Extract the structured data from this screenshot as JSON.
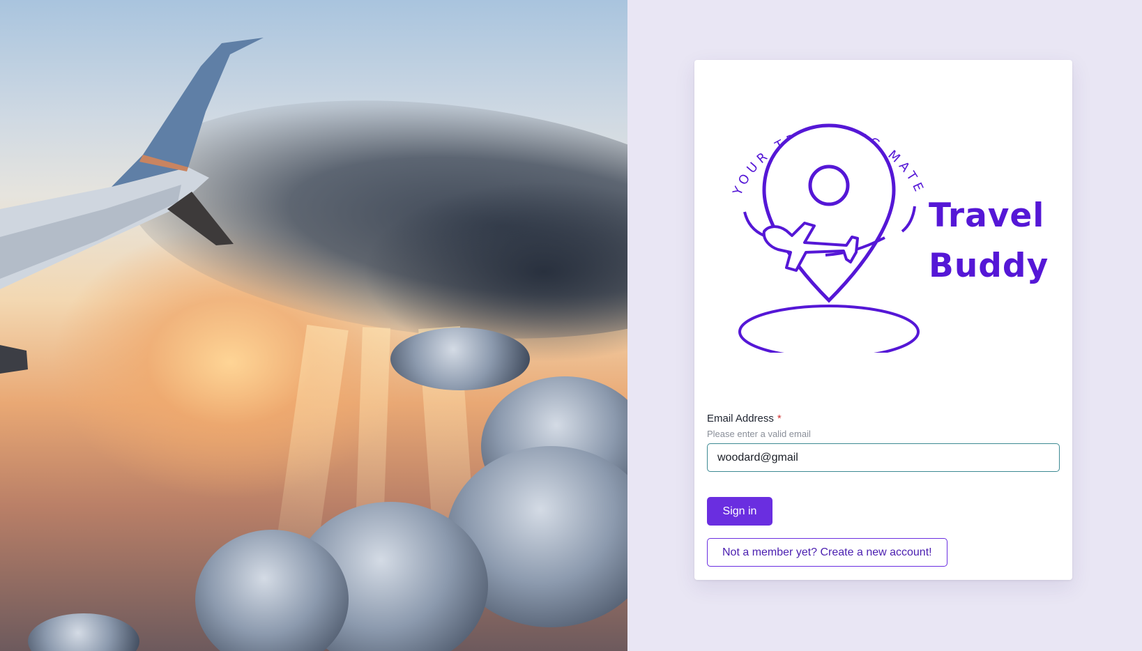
{
  "hero": {
    "icon": "airplane-wing-sunset-photo"
  },
  "brand": {
    "tagline": "YOUR TRAVELING MATE",
    "name_line1": "Travel",
    "name_line2": "Buddy",
    "color": "#5517d6",
    "icon": "map-pin-airplane-icon"
  },
  "form": {
    "email_label": "Email Address",
    "required_mark": "*",
    "email_hint": "Please enter a valid email",
    "email_value": "woodard@gmail",
    "sign_in_label": "Sign in",
    "create_account_label": "Not a member yet? Create a new account!"
  },
  "colors": {
    "accent": "#6a2ee0",
    "panel_bg": "#e9e6f4",
    "input_border": "#3d8a93",
    "required": "#d0302f"
  }
}
